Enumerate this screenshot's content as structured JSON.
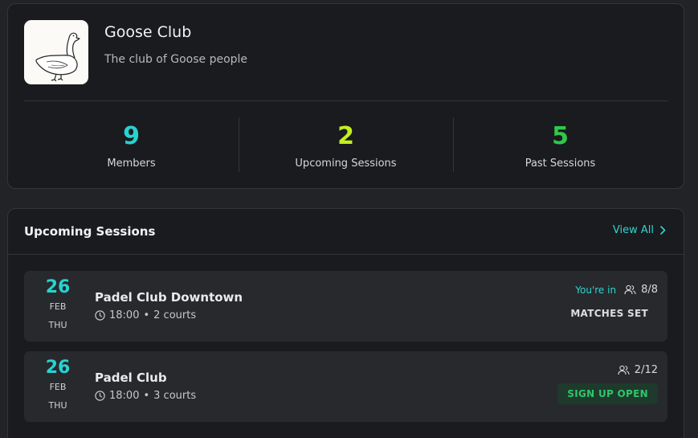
{
  "club": {
    "name": "Goose Club",
    "description": "The club of Goose people",
    "stats": [
      {
        "value": "9",
        "label": "Members",
        "color": "#27d3d0"
      },
      {
        "value": "2",
        "label": "Upcoming Sessions",
        "color": "#c4ef1e"
      },
      {
        "value": "5",
        "label": "Past Sessions",
        "color": "#2fc94a"
      }
    ]
  },
  "upcoming": {
    "title": "Upcoming Sessions",
    "view_all": "View All",
    "sessions": [
      {
        "day": "26",
        "month": "FEB",
        "weekday": "THU",
        "name": "Padel Club Downtown",
        "time": "18:00",
        "courts": "2 courts",
        "joined_label": "You're in",
        "count": "8/8",
        "status": "MATCHES SET"
      },
      {
        "day": "26",
        "month": "FEB",
        "weekday": "THU",
        "name": "Padel Club",
        "time": "18:00",
        "courts": "3 courts",
        "count": "2/12",
        "status": "SIGN UP OPEN"
      }
    ]
  },
  "colors": {
    "accent_cyan": "#27d3d0",
    "accent_lime": "#c4ef1e",
    "accent_green": "#2fc94a",
    "signup_bg": "#1e3a2c"
  }
}
